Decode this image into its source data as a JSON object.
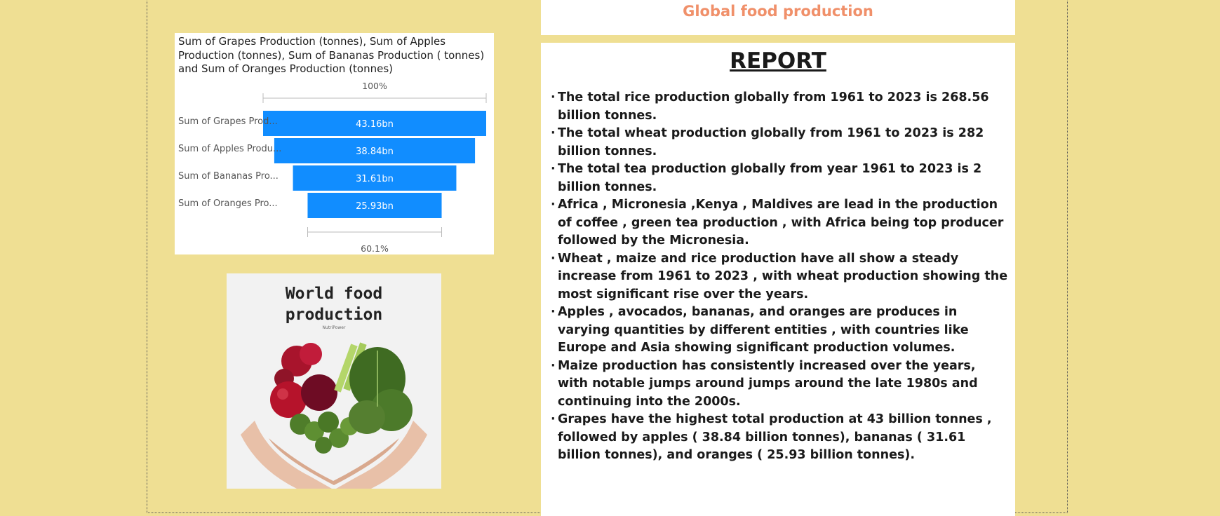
{
  "chart_data": {
    "type": "funnel",
    "title": "Sum of Grapes Production (tonnes), Sum of Apples Production (tonnes), Sum of Bananas Production ( tonnes) and Sum of Oranges Production (tonnes)",
    "categories": [
      "Sum of Grapes Prod...",
      "Sum of Apples Produ...",
      "Sum of Bananas Pro...",
      "Sum of Oranges Pro..."
    ],
    "values": [
      43.16,
      38.84,
      31.61,
      25.93
    ],
    "value_labels": [
      "43.16bn",
      "38.84bn",
      "31.61bn",
      "25.93bn"
    ],
    "units": "bn",
    "top_percent_label": "100%",
    "bottom_percent_label": "60.1%",
    "bar_color": "#118dff"
  },
  "poster": {
    "title_line1": "World food",
    "title_line2": "production",
    "brand": "NutriPower"
  },
  "header": {
    "title": "Global food production",
    "title_color": "#f0906a"
  },
  "report": {
    "title": "REPORT",
    "bullet": "·",
    "items": [
      "The total rice production globally from 1961 to 2023 is 268.56 billion tonnes.",
      "The total wheat production globally from 1961 to 2023 is 282 billion tonnes.",
      "The total tea production globally from year 1961 to 2023 is 2 billion tonnes.",
      "Africa , Micronesia ,Kenya , Maldives are lead in the production of coffee , green tea production , with Africa being top producer followed by the Micronesia.",
      "Wheat , maize and rice production have all show a steady increase from 1961 to 2023 , with wheat production showing the most significant rise over the years.",
      "Apples , avocados, bananas, and oranges are produces in varying quantities by different entities , with countries like Europe and  Asia showing significant production volumes.",
      "Maize production has consistently increased over the years, with notable jumps around jumps around the late 1980s and continuing into the 2000s.",
      "Grapes have the highest total production at 43 billion tonnes , followed by apples ( 38.84 billion tonnes), bananas ( 31.61 billion tonnes), and oranges    ( 25.93 billion tonnes)."
    ]
  },
  "colors": {
    "background": "#efdf93",
    "panel": "#ffffff"
  }
}
